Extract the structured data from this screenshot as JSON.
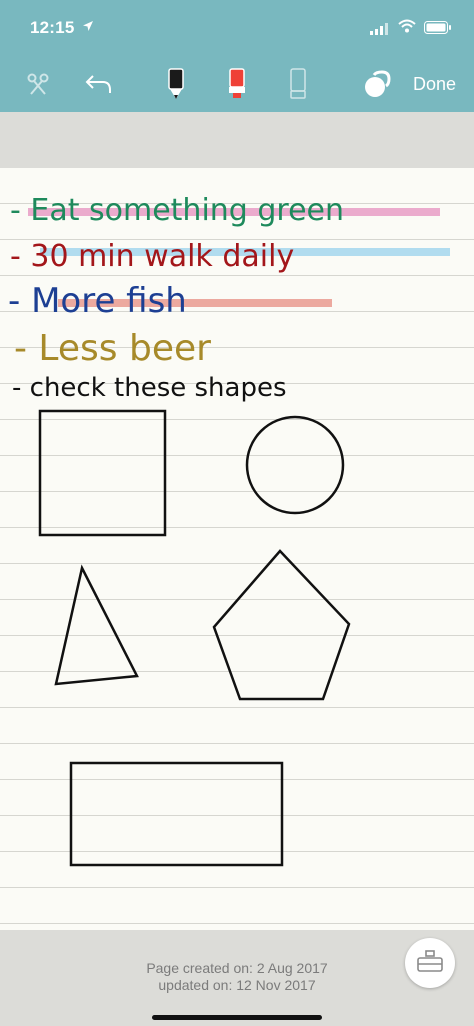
{
  "status_bar": {
    "time": "12:15",
    "location_icon": "location-arrow-icon",
    "signal_icon": "cellular-signal-icon",
    "wifi_icon": "wifi-icon",
    "battery_icon": "battery-icon"
  },
  "toolbar": {
    "lasso_icon": "lasso-scissors-icon",
    "undo_icon": "undo-icon",
    "pen_icon": "black-pen-icon",
    "highlighter_icon": "red-highlighter-icon",
    "eraser_icon": "eraser-icon",
    "layers_icon": "layers-icon",
    "done_label": "Done"
  },
  "notes": {
    "lines": [
      {
        "text": "- Eat something green",
        "color": "#1e8a5c",
        "highlight": "#e79cc6"
      },
      {
        "text": "- 30 min walk daily",
        "color": "#a3161a",
        "highlight": "#a9d8ee"
      },
      {
        "text": "- More fish",
        "color": "#1d3f93",
        "highlight": "#eaa096"
      },
      {
        "text": "- Less beer",
        "color": "#a78a2a",
        "highlight": ""
      },
      {
        "text": "- check these shapes",
        "color": "#111111",
        "highlight": ""
      }
    ],
    "shapes": [
      "square",
      "circle",
      "triangle",
      "pentagon",
      "rectangle"
    ]
  },
  "footer": {
    "created_label": "Page created on: 2 Aug 2017",
    "updated_label": "updated on: 12 Nov 2017",
    "page_button_icon": "page-settings-icon"
  }
}
